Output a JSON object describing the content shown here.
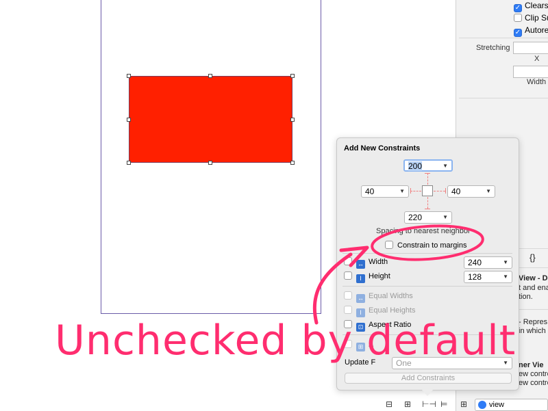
{
  "inspector": {
    "checkboxes": [
      {
        "label": "Clears",
        "checked": true
      },
      {
        "label": "Clip Su",
        "checked": false
      },
      {
        "label": "Autore",
        "checked": true
      }
    ],
    "stretching_label": "Stretching",
    "x_label": "X",
    "width_label": "Width",
    "braces": "{}",
    "frag_view": "View - Di",
    "frag_enable": "t and ena",
    "frag_tion": "tion.",
    "frag_repres": "- Repres",
    "frag_which": "in which",
    "frag_ner": "ner Vie",
    "frag_ctrl1": "ew contro",
    "frag_ctrl2": "ew contro"
  },
  "popover": {
    "title": "Add New Constraints",
    "top_value": "200",
    "left_value": "40",
    "right_value": "40",
    "bottom_value": "220",
    "spacing_label": "Spacing to nearest neighbor",
    "constrain_margins": {
      "label": "Constrain to margins",
      "checked": false
    },
    "width": {
      "label": "Width",
      "value": "240",
      "checked": false
    },
    "height": {
      "label": "Height",
      "value": "128",
      "checked": false
    },
    "equal_widths": {
      "label": "Equal Widths",
      "checked": false
    },
    "equal_heights": {
      "label": "Equal Heights",
      "checked": false
    },
    "aspect_ratio": {
      "label": "Aspect Ratio",
      "checked": false
    },
    "align_label": "A",
    "update_label": "Update F",
    "update_value": "One",
    "add_button": "Add Constraints"
  },
  "toolbar": {
    "view_label": "view"
  },
  "annotation": {
    "text": "Unchecked by default",
    "color": "#ff2d6f"
  },
  "colors": {
    "red_view": "#ff2000",
    "accent": "#2f7cf6"
  }
}
